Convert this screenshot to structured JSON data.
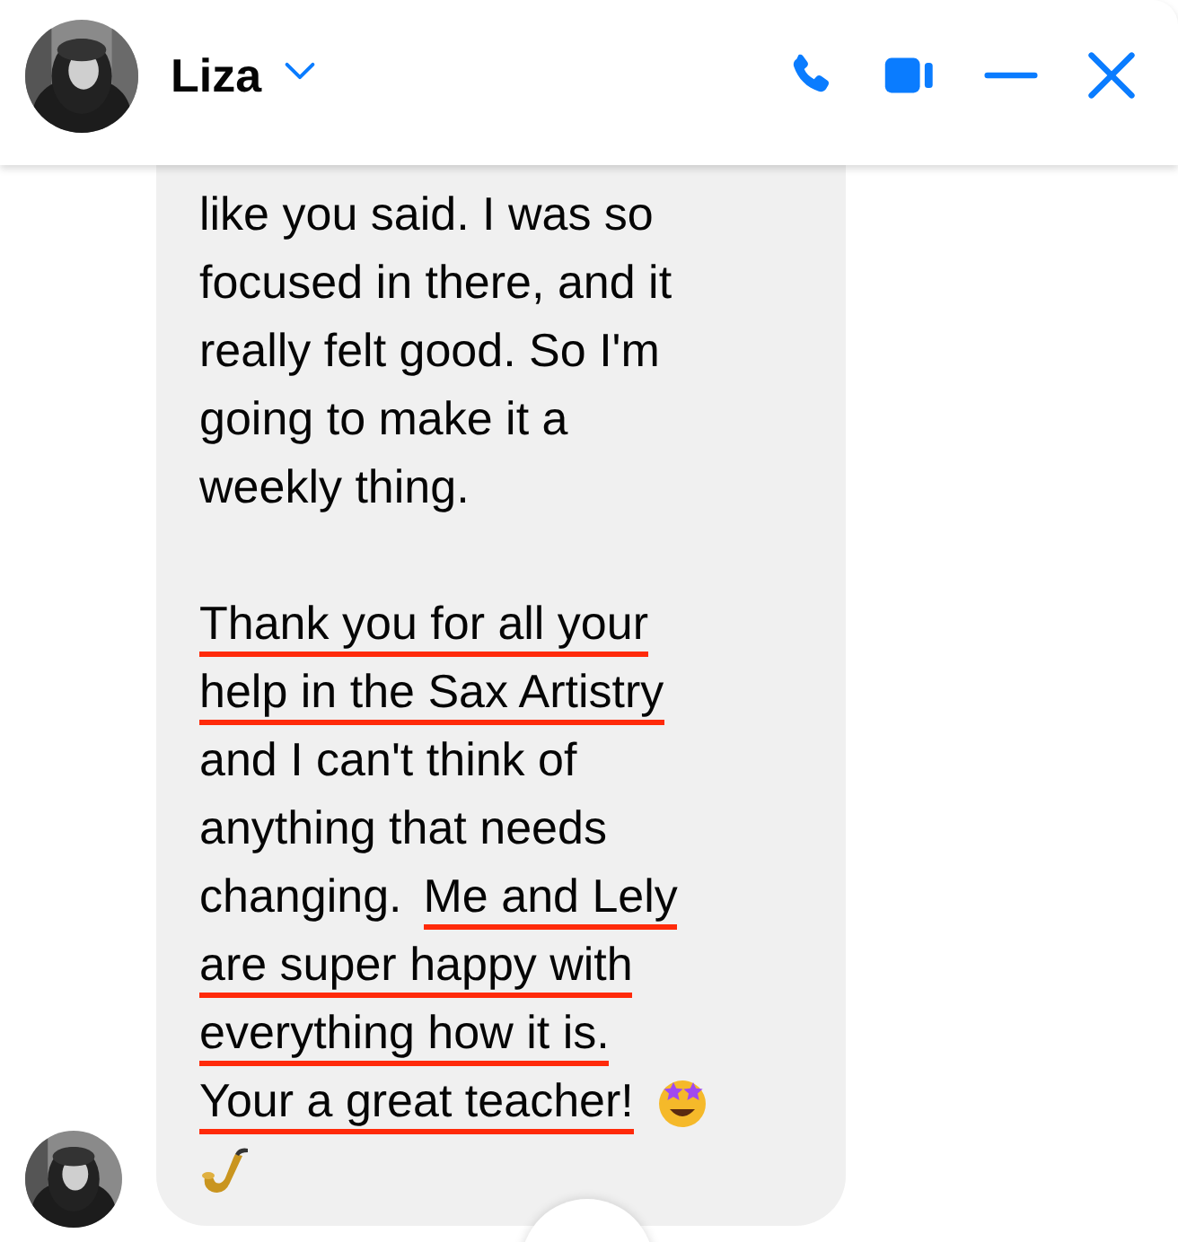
{
  "header": {
    "name": "Liza"
  },
  "message": {
    "paragraphs": [
      [
        [
          {
            "kind": "text",
            "text": "like you said. I was so",
            "underlined": false
          }
        ],
        [
          {
            "kind": "text",
            "text": "focused in there, and it",
            "underlined": false
          }
        ],
        [
          {
            "kind": "text",
            "text": "really felt good. So I'm",
            "underlined": false
          }
        ],
        [
          {
            "kind": "text",
            "text": "going to make it a",
            "underlined": false
          }
        ],
        [
          {
            "kind": "text",
            "text": "weekly thing.",
            "underlined": false
          }
        ]
      ],
      [
        [
          {
            "kind": "text",
            "text": "Thank you for all your",
            "underlined": true
          }
        ],
        [
          {
            "kind": "text",
            "text": "help in the Sax Artistry",
            "underlined": true
          }
        ],
        [
          {
            "kind": "text",
            "text": "and I can't think of",
            "underlined": false
          }
        ],
        [
          {
            "kind": "text",
            "text": "anything that needs",
            "underlined": false
          }
        ],
        [
          {
            "kind": "text",
            "text": "changing.",
            "underlined": false
          },
          {
            "kind": "text",
            "text": "Me and Lely",
            "underlined": true
          }
        ],
        [
          {
            "kind": "text",
            "text": "are super happy with",
            "underlined": true
          }
        ],
        [
          {
            "kind": "text",
            "text": "everything how it is.",
            "underlined": true
          }
        ],
        [
          {
            "kind": "text",
            "text": "Your a great teacher!",
            "underlined": true
          },
          {
            "kind": "emoji"
          }
        ],
        [
          {
            "kind": "emoji"
          }
        ]
      ]
    ]
  }
}
